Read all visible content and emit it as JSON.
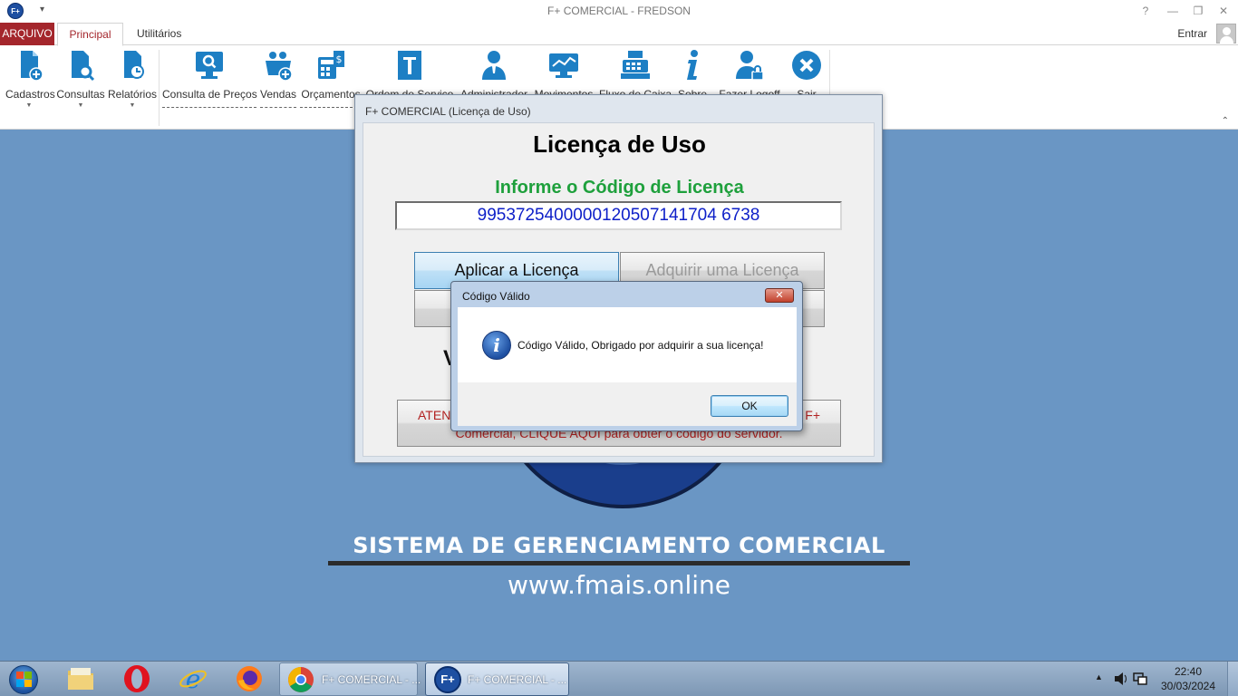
{
  "window": {
    "title": "F+ COMERCIAL - FREDSON",
    "app_icon_text": "F+",
    "qat_label": "▾",
    "help_label": "?",
    "minimize_label": "—",
    "restore_label": "❐",
    "close_label": "✕"
  },
  "ribbon_tabs": {
    "arquivo": "ARQUIVO",
    "principal": "Principal",
    "utilitarios": "Utilitários",
    "entrar": "Entrar"
  },
  "ribbon": {
    "items": [
      {
        "label": "Cadastros",
        "icon": "document-add-icon"
      },
      {
        "label": "Consultas",
        "icon": "document-search-icon"
      },
      {
        "label": "Relatórios",
        "icon": "document-report-icon"
      },
      {
        "label": "Consulta de Preços",
        "icon": "monitor-search-icon"
      },
      {
        "label": "Vendas",
        "icon": "shopping-basket-icon"
      },
      {
        "label": "Orçamentos",
        "icon": "calculator-icon"
      },
      {
        "label": "Ordem de Serviço",
        "icon": "service-order-icon"
      },
      {
        "label": "Administrador",
        "icon": "administrator-icon"
      },
      {
        "label": "Movimentos",
        "icon": "monitor-chart-icon"
      },
      {
        "label": "Fluxo de Caixa",
        "icon": "cash-register-icon"
      },
      {
        "label": "Sobre",
        "icon": "info-icon"
      },
      {
        "label": "Fazer Logoff",
        "icon": "user-lock-icon"
      },
      {
        "label": "Sair",
        "icon": "close-circle-icon"
      }
    ],
    "collapse_label": "⌃"
  },
  "desktop": {
    "system_title": "SISTEMA DE GERENCIAMENTO COMERCIAL",
    "website": "www.fmais.online"
  },
  "license_window": {
    "title": "F+ COMERCIAL (Licença de Uso)",
    "heading": "Licença de Uso",
    "subheading": "Informe o Código de Licença",
    "code": "9953725400000120507141704 6738",
    "apply_button": "Aplicar a Licença",
    "buy_button": "Adquirir uma Licença",
    "partial_text": "V",
    "attention_line1": "ATEN",
    "attention_line1_end": "F+",
    "attention_line2": "Comercial, CLIQUE AQUI para obter o código do servidor."
  },
  "message_box": {
    "title": "Código Válido",
    "text": "Código Válido, Obrigado por adquirir a sua licença!",
    "ok_button": "OK",
    "close_label": "✕"
  },
  "taskbar": {
    "tasks": [
      {
        "label": "F+ COMERCIAL - ...",
        "icon": "chrome-icon"
      },
      {
        "label": "F+ COMERCIAL - ...",
        "icon": "fplus-app-icon"
      }
    ],
    "tray_arrow": "▲",
    "time": "22:40",
    "date": "30/03/2024"
  },
  "colors": {
    "accent_red": "#a4262c",
    "subheading_green": "#1ea03c",
    "code_blue": "#0d1fc8",
    "desktop_blue": "#6a96c4"
  }
}
